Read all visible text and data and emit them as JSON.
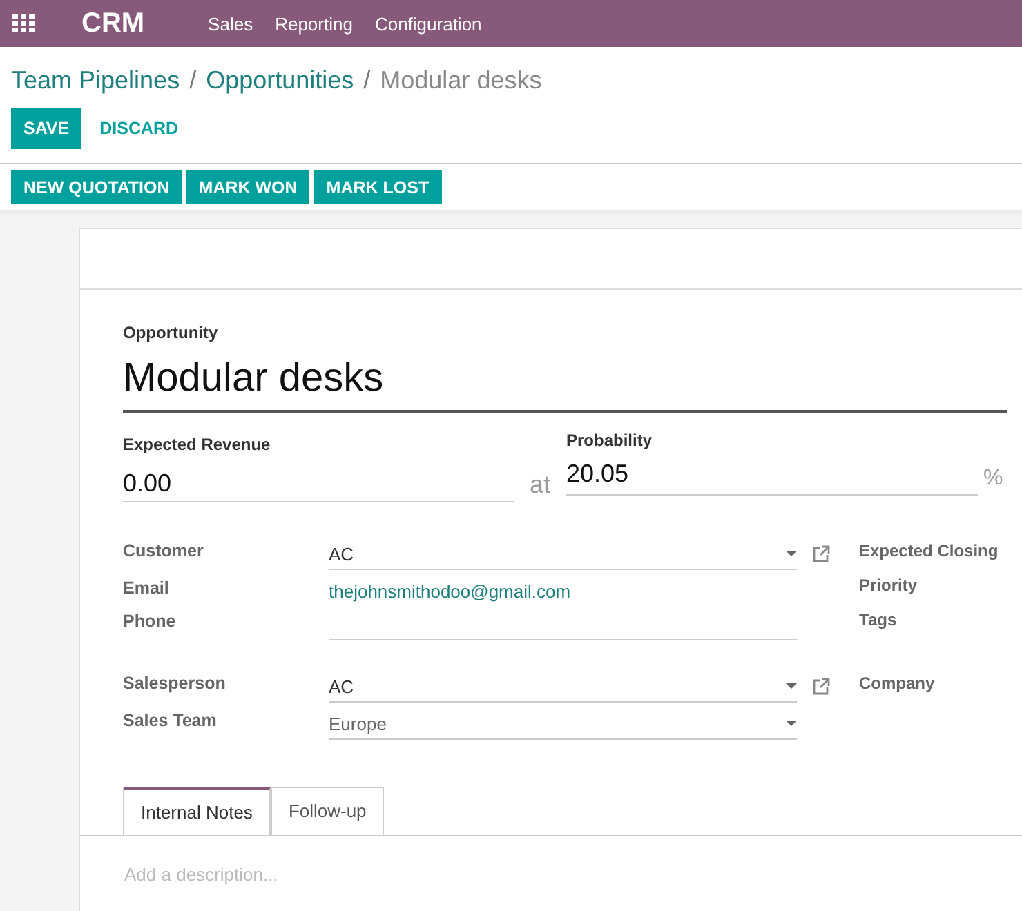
{
  "navbar": {
    "app": "CRM",
    "menu": [
      "Sales",
      "Reporting",
      "Configuration"
    ]
  },
  "breadcrumb_separator": "/",
  "breadcrumb": [
    {
      "label": "Team Pipelines",
      "link": true
    },
    {
      "label": "Opportunities",
      "link": true
    },
    {
      "label": "Modular desks",
      "link": false
    }
  ],
  "actions": {
    "save": "SAVE",
    "discard": "DISCARD"
  },
  "status_buttons": [
    "NEW QUOTATION",
    "MARK WON",
    "MARK LOST"
  ],
  "form": {
    "title_label": "Opportunity",
    "title": "Modular desks",
    "revenue": {
      "label": "Expected Revenue",
      "value": "0.00"
    },
    "at": "at",
    "probability": {
      "label": "Probability",
      "value": "20.05",
      "unit": "%"
    },
    "groups": [
      {
        "left": [
          {
            "label": "Customer",
            "kind": "many2one",
            "value": "AC"
          },
          {
            "label": "Email",
            "kind": "link",
            "value": "thejohnsmithodoo@gmail.com"
          },
          {
            "label": "Phone",
            "kind": "text"
          }
        ],
        "right": [
          "Expected Closing",
          "Priority",
          "Tags"
        ]
      },
      {
        "left": [
          {
            "label": "Salesperson",
            "kind": "many2one",
            "value": "AC"
          },
          {
            "label": "Sales Team",
            "kind": "select",
            "value": "Europe"
          }
        ],
        "right": [
          "Company"
        ]
      }
    ],
    "tabs": [
      {
        "label": "Internal Notes",
        "selected": true
      },
      {
        "label": "Follow-up",
        "selected": false
      }
    ],
    "notes_placeholder": "Add a description..."
  }
}
